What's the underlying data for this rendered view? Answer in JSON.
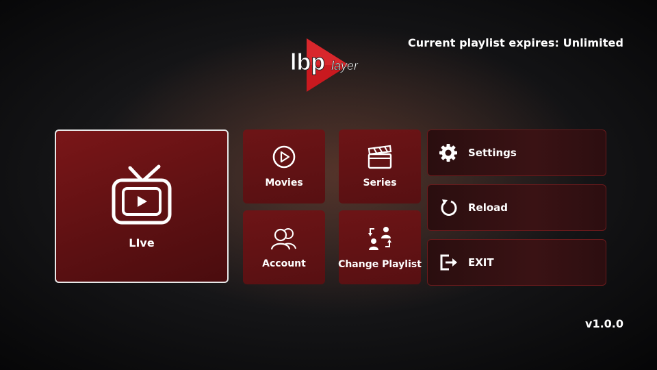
{
  "header": {
    "expiry_text": "Current playlist expires: Unlimited"
  },
  "logo": {
    "text": "lbPlayer"
  },
  "tiles": {
    "live": "LIve",
    "movies": "Movies",
    "series": "Series",
    "account": "Account",
    "change_playlist": "Change Playlist"
  },
  "actions": {
    "settings": "Settings",
    "reload": "Reload",
    "exit": "EXIT"
  },
  "footer": {
    "version": "v1.0.0"
  },
  "colors": {
    "accent_red": "#c4161c",
    "tile_red": "#6d1416"
  }
}
